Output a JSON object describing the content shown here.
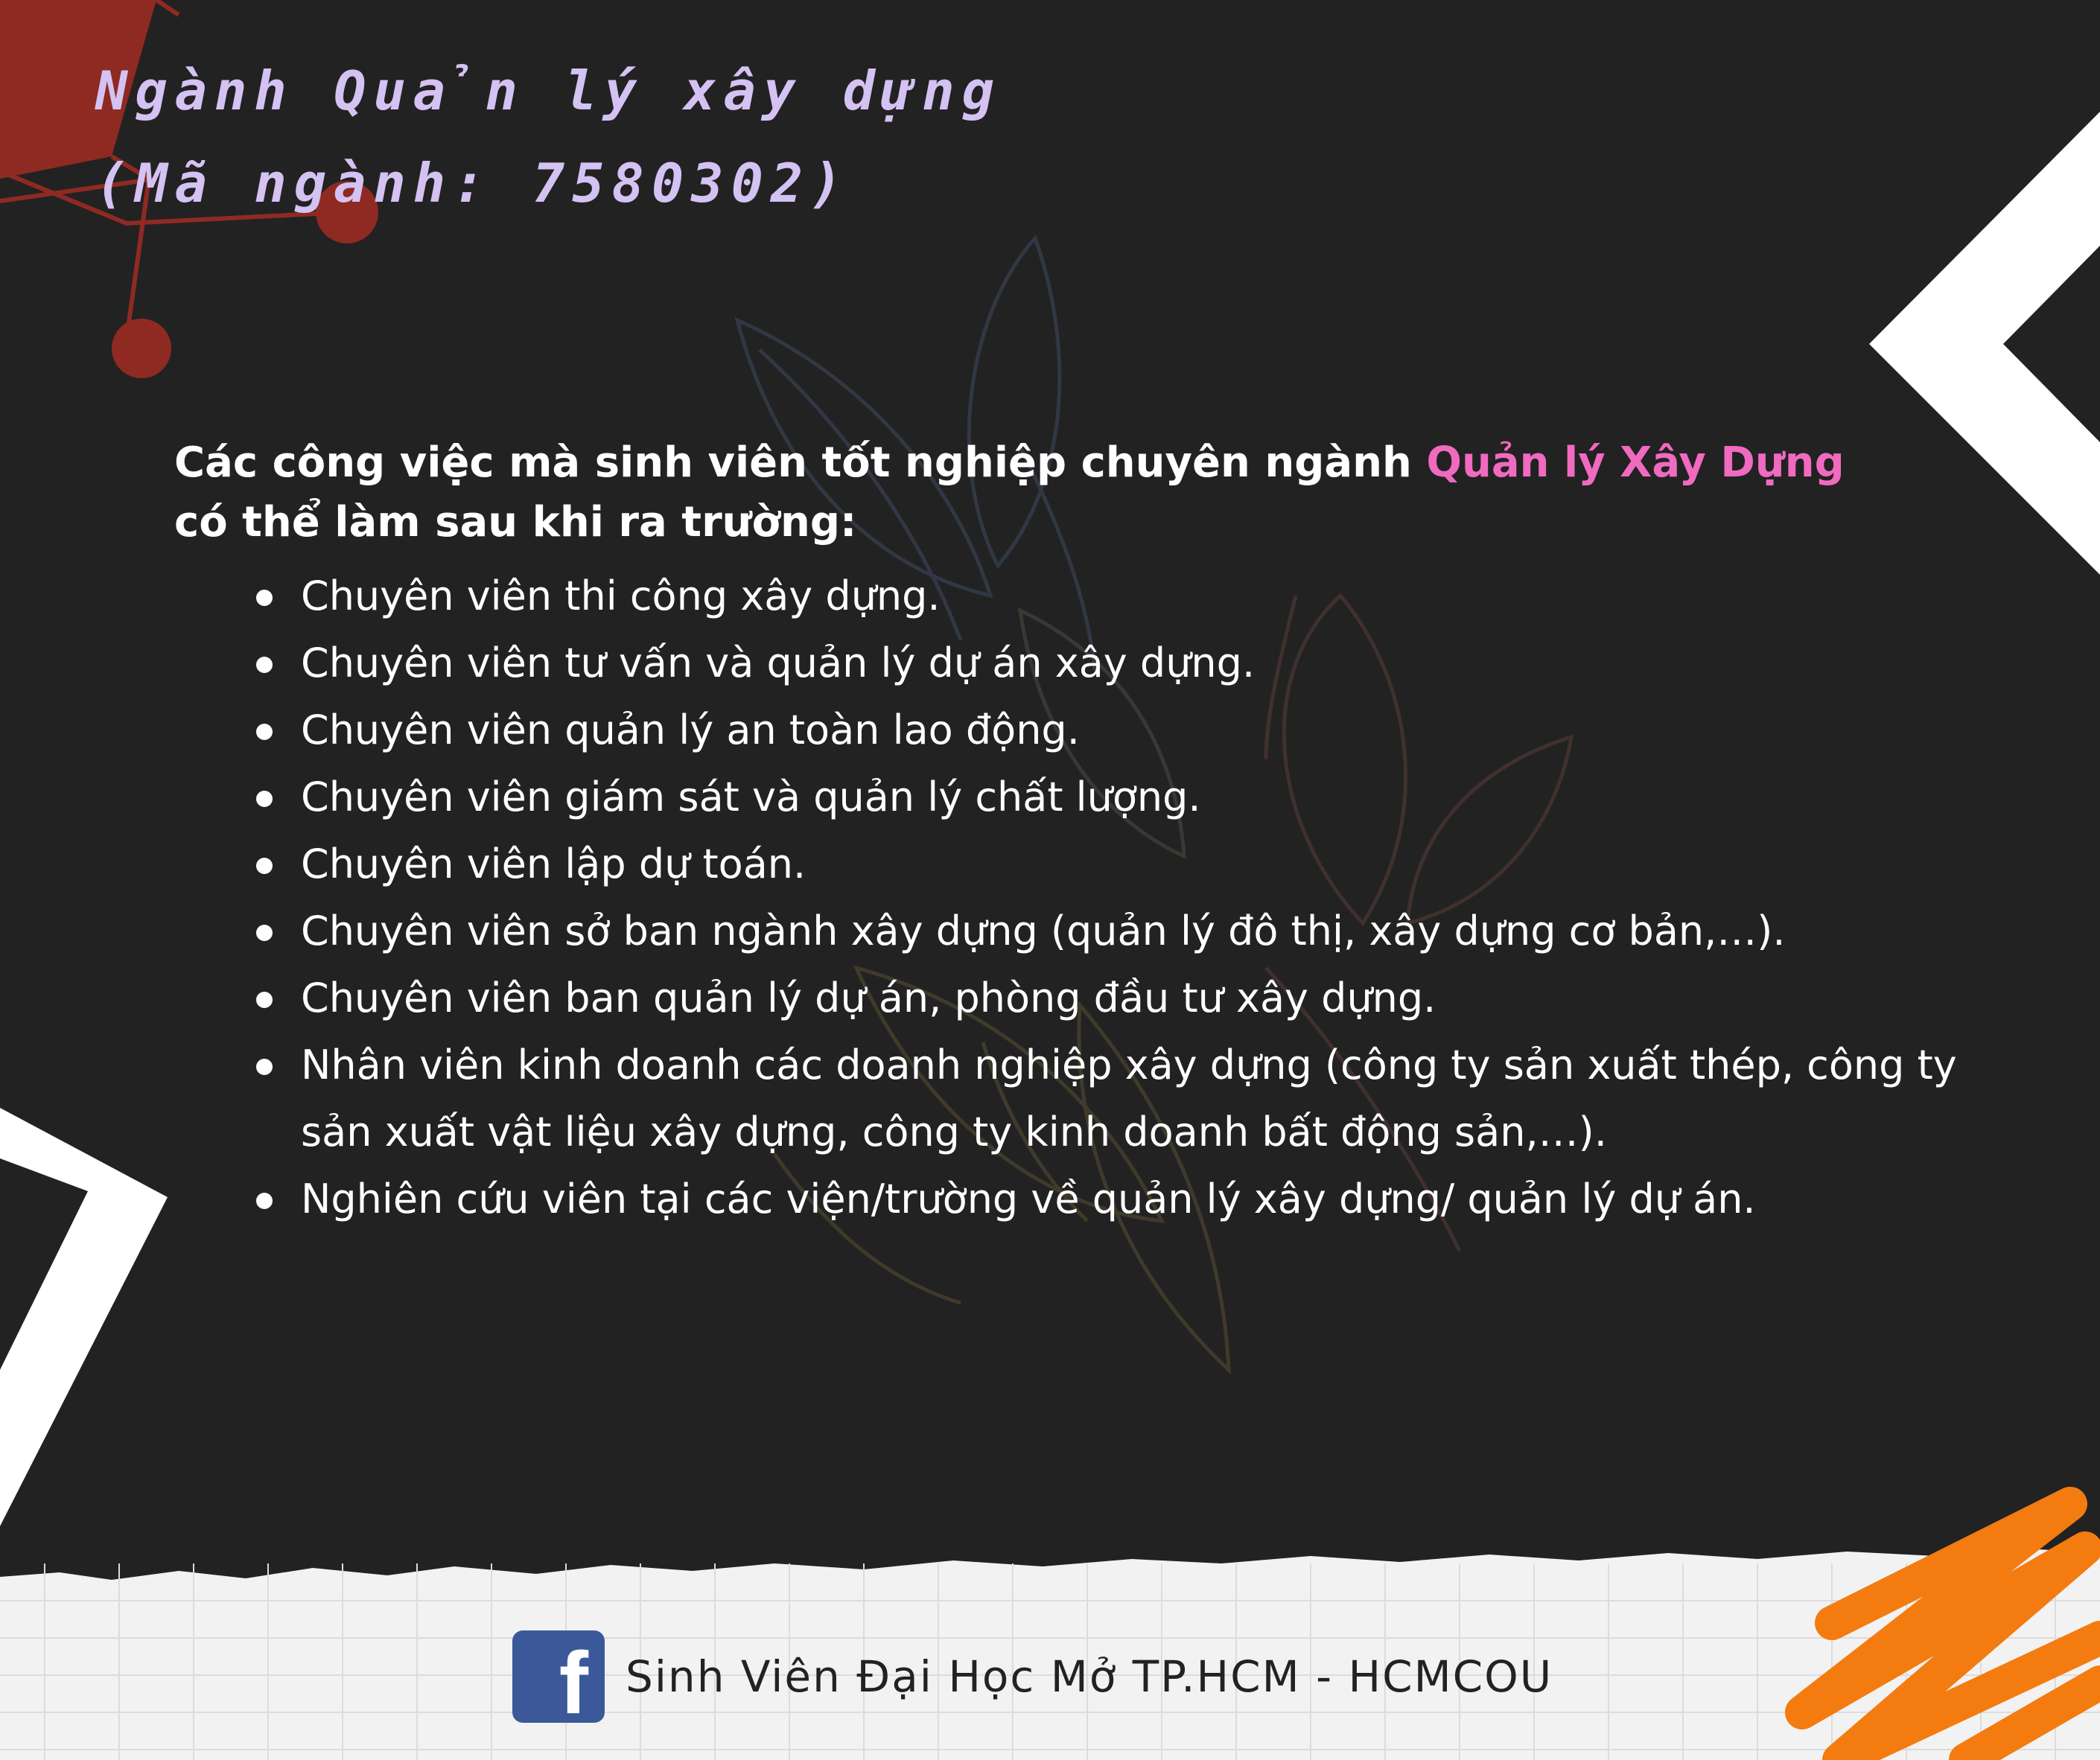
{
  "header": {
    "title_line1": "Ngành Quản lý xây dựng",
    "title_line2": "(Mã ngành: 7580302)"
  },
  "intro": {
    "text_before": "Các công việc mà sinh viên tốt nghiệp chuyên ngành ",
    "highlight": "Quản lý Xây Dựng",
    "text_after": "có thể làm sau khi ra trường:"
  },
  "jobs": [
    "Chuyên viên thi công xây dựng.",
    "Chuyên viên tư vấn và quản lý dự án xây dựng.",
    "Chuyên viên quản lý an toàn lao động.",
    "Chuyên viên giám sát và quản lý chất lượng.",
    "Chuyên viên lập dự toán.",
    "Chuyên viên sở ban ngành xây dựng (quản lý đô thị, xây dựng cơ bản,…).",
    "Chuyên viên ban quản lý dự án, phòng đầu tư xây dựng.",
    "Nhân viên kinh doanh các doanh nghiệp xây dựng (công ty sản xuất thép, công ty sản xuất vật liệu xây dựng, công ty kinh doanh bất động sản,…).",
    "Nghiên cứu viên tại các viện/trường về quản lý xây dựng/ quản lý dự án."
  ],
  "footer": {
    "icon": "facebook-icon",
    "text": "Sinh Viên Đại Học Mở TP.HCM - HCMCOU"
  },
  "colors": {
    "background": "#222222",
    "title": "#d4c2f3",
    "highlight": "#f06ac0",
    "accent_red": "#8f2a22",
    "accent_orange": "#f47b0f",
    "facebook_blue": "#3b5998"
  }
}
